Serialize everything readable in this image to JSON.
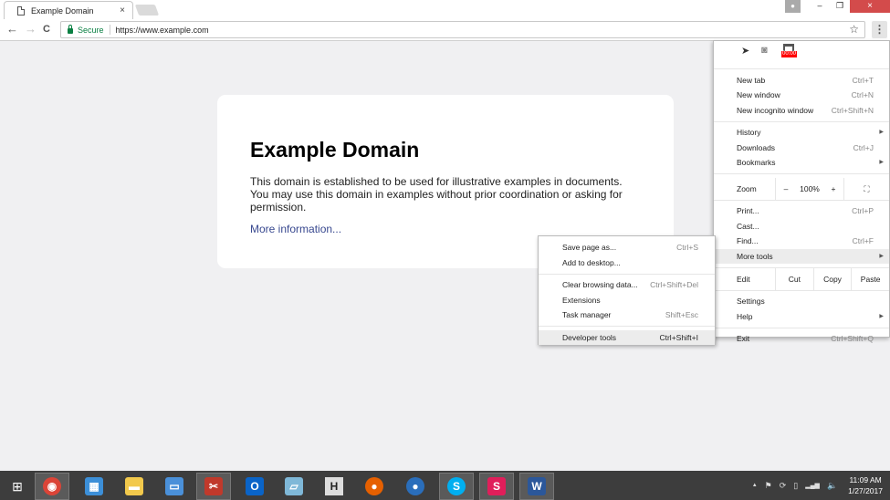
{
  "browser": {
    "tab": {
      "title": "Example Domain",
      "close_glyph": "×"
    },
    "window_controls": {
      "profile_glyph": "👤",
      "minimize": "–",
      "restore": "❐",
      "close": "×"
    },
    "toolbar": {
      "back": "←",
      "forward": "→",
      "reload": "C",
      "secure_label": "Secure",
      "url": "https://www.example.com",
      "star": "☆",
      "menu_glyph": "⋮"
    }
  },
  "page": {
    "heading": "Example Domain",
    "paragraph": "This domain is established to be used for illustrative examples in documents. You may use this domain in examples without prior coordination or asking for permission.",
    "link": "More information..."
  },
  "chrome_menu": {
    "extensions": [
      {
        "name": "pin",
        "glyph": "✎"
      },
      {
        "name": "camera",
        "glyph": "📷"
      },
      {
        "name": "timer",
        "badge": "00:00"
      }
    ],
    "group1": [
      {
        "label": "New tab",
        "shortcut": "Ctrl+T"
      },
      {
        "label": "New window",
        "shortcut": "Ctrl+N"
      },
      {
        "label": "New incognito window",
        "shortcut": "Ctrl+Shift+N"
      }
    ],
    "group2": [
      {
        "label": "History",
        "arrow": "▶"
      },
      {
        "label": "Downloads",
        "shortcut": "Ctrl+J"
      },
      {
        "label": "Bookmarks",
        "arrow": "▶"
      }
    ],
    "zoom": {
      "label": "Zoom",
      "minus": "–",
      "value": "100%",
      "plus": "+",
      "fullscreen": "⛶"
    },
    "group3": [
      {
        "label": "Print...",
        "shortcut": "Ctrl+P"
      },
      {
        "label": "Cast..."
      },
      {
        "label": "Find...",
        "shortcut": "Ctrl+F"
      },
      {
        "label": "More tools",
        "arrow": "▶"
      }
    ],
    "edit": {
      "label": "Edit",
      "cut": "Cut",
      "copy": "Copy",
      "paste": "Paste"
    },
    "group4": [
      {
        "label": "Settings"
      },
      {
        "label": "Help",
        "arrow": "▶"
      }
    ],
    "exit": {
      "label": "Exit",
      "shortcut": "Ctrl+Shift+Q"
    }
  },
  "more_tools_menu": {
    "group1": [
      {
        "label": "Save page as...",
        "shortcut": "Ctrl+S"
      },
      {
        "label": "Add to desktop..."
      }
    ],
    "group2": [
      {
        "label": "Clear browsing data...",
        "shortcut": "Ctrl+Shift+Del"
      },
      {
        "label": "Extensions"
      },
      {
        "label": "Task manager",
        "shortcut": "Shift+Esc"
      }
    ],
    "group3": [
      {
        "label": "Developer tools",
        "shortcut": "Ctrl+Shift+I"
      }
    ]
  },
  "taskbar": {
    "start_glyph": "⊞",
    "apps": [
      {
        "name": "chrome",
        "glyph": "◉",
        "color": "#db4437",
        "active": true
      },
      {
        "name": "control-panel",
        "glyph": "▦",
        "color": "#3c8fd8"
      },
      {
        "name": "file-explorer",
        "glyph": "▬",
        "color": "#f2c94c"
      },
      {
        "name": "remote-desktop",
        "glyph": "▭",
        "color": "#4a90d9"
      },
      {
        "name": "snipping-tool",
        "glyph": "✂",
        "color": "#c0392b",
        "active": true
      },
      {
        "name": "outlook",
        "glyph": "O",
        "color": "#0a64c8"
      },
      {
        "name": "notepad",
        "glyph": "▱",
        "color": "#7fb8d8"
      },
      {
        "name": "h-app",
        "glyph": "H",
        "color": "#dddddd"
      },
      {
        "name": "firefox",
        "glyph": "●",
        "color": "#e66000"
      },
      {
        "name": "firefox-dev",
        "glyph": "●",
        "color": "#2a6ebb"
      },
      {
        "name": "skype",
        "glyph": "S",
        "color": "#00aff0",
        "active": true
      },
      {
        "name": "slack",
        "glyph": "S",
        "color": "#e01e5a",
        "active": true
      },
      {
        "name": "word",
        "glyph": "W",
        "color": "#2b579a",
        "active": true
      }
    ],
    "tray": {
      "chevron": "▲",
      "icons": [
        "⚑",
        "⟳",
        "▯",
        "▂▄▆",
        "🔈"
      ],
      "time": "11:09 AM",
      "date": "1/27/2017"
    }
  }
}
